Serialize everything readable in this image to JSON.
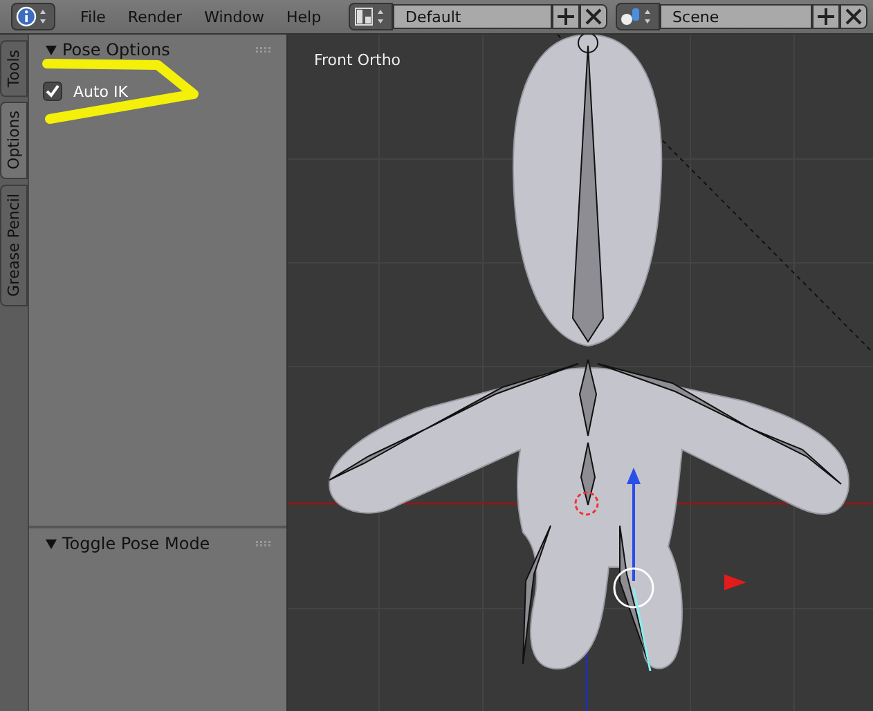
{
  "header": {
    "menus": [
      "File",
      "Render",
      "Window",
      "Help"
    ],
    "layout": {
      "value": "Default"
    },
    "scene": {
      "value": "Scene"
    }
  },
  "tool_shelf": {
    "tabs": [
      {
        "label": "Tools",
        "selected": false
      },
      {
        "label": "Options",
        "selected": true
      },
      {
        "label": "Grease Pencil",
        "selected": false
      }
    ],
    "panels": [
      {
        "title": "Pose Options",
        "expanded": true,
        "options": [
          {
            "label": "Auto IK",
            "checked": true
          }
        ]
      },
      {
        "title": "Toggle Pose Mode",
        "expanded": true
      }
    ]
  },
  "viewport": {
    "label": "Front Ortho"
  }
}
